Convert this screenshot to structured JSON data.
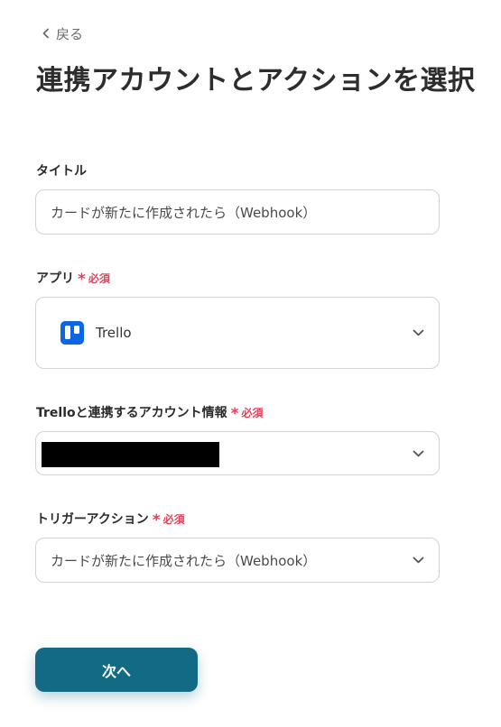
{
  "back": {
    "label": "戻る"
  },
  "page_title": "連携アカウントとアクションを選択",
  "required_label": "必須",
  "required_mark": "*",
  "fields": {
    "title": {
      "label": "タイトル",
      "value": "カードが新たに作成されたら（Webhook）"
    },
    "app": {
      "label": "アプリ",
      "value": "Trello",
      "icon": "trello-logo-icon"
    },
    "account": {
      "label": "Trelloと連携するアカウント情報",
      "value": "",
      "redacted": true
    },
    "trigger": {
      "label": "トリガーアクション",
      "value": "カードが新たに作成されたら（Webhook）"
    }
  },
  "next_button": {
    "label": "次へ"
  },
  "colors": {
    "primary": "#136a85",
    "required": "#e3435a",
    "trello": "#0c66e4",
    "border": "#d3d3d3"
  }
}
